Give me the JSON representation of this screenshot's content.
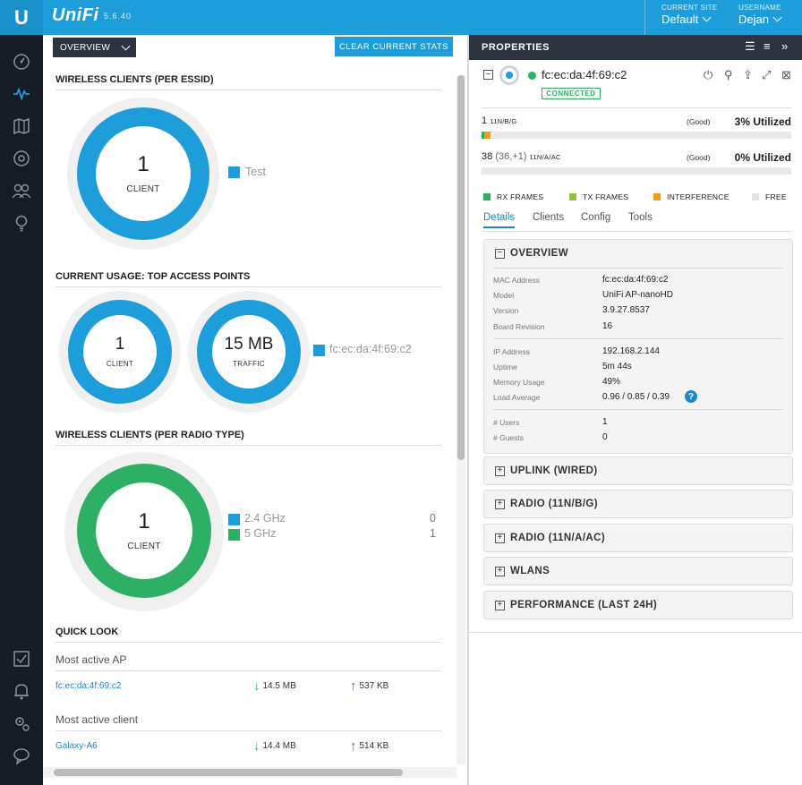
{
  "app": {
    "logo_letter": "U",
    "brand": "UniFi",
    "version": "5.6.40"
  },
  "topbar": {
    "site_label": "CURRENT SITE",
    "site_value": "Default",
    "user_label": "USERNAME",
    "user_value": "Dejan"
  },
  "sidebar": {
    "items": [
      "dashboard-icon",
      "statistics-icon",
      "map-icon",
      "devices-icon",
      "clients-icon",
      "insights-icon",
      "alerts-checklist-icon",
      "events-bell-icon",
      "settings-icon",
      "chat-icon"
    ]
  },
  "main": {
    "view_select": "OVERVIEW",
    "clear_button": "CLEAR CURRENT STATS",
    "wc_essid": {
      "title": "WIRELESS CLIENTS (PER ESSID)",
      "count": "1",
      "unit": "CLIENT",
      "legend": [
        {
          "label": "Test",
          "color": "#1e9ddb"
        }
      ]
    },
    "usage": {
      "title": "CURRENT USAGE: TOP ACCESS POINTS",
      "clients_value": "1",
      "clients_unit": "CLIENT",
      "traffic_value": "15 MB",
      "traffic_unit": "TRAFFIC",
      "legend": "fc:ec:da:4f:69:c2"
    },
    "wc_radio": {
      "title": "WIRELESS CLIENTS (PER RADIO TYPE)",
      "count": "1",
      "unit": "CLIENT",
      "legend": [
        {
          "label": "2.4 GHz",
          "count": "0",
          "color": "#1e9ddb"
        },
        {
          "label": "5 GHz",
          "count": "1",
          "color": "#2db063"
        }
      ]
    },
    "quick_look": {
      "title": "QUICK LOOK",
      "ap_label": "Most active AP",
      "ap_name": "fc:ec:da:4f:69:c2",
      "ap_down": "14.5 MB",
      "ap_up": "537 KB",
      "client_label": "Most active client",
      "client_name": "Galaxy-A6",
      "client_down": "14.4 MB",
      "client_up": "514 KB"
    }
  },
  "properties": {
    "title": "PROPERTIES",
    "device_name": "fc:ec:da:4f:69:c2",
    "status": "CONNECTED",
    "radio1": {
      "count": "1",
      "band": "11N/B/G",
      "quality": "(Good)",
      "util": "3% Utilized",
      "util_value": 0.03
    },
    "radio2": {
      "count": "38",
      "extra": "(36,+1)",
      "band": "11N/A/AC",
      "quality": "(Good)",
      "util": "0% Utilized",
      "util_value": 0.0
    },
    "key": [
      {
        "label": "RX FRAMES",
        "color": "#2db063"
      },
      {
        "label": "TX FRAMES",
        "color": "#8cc63f"
      },
      {
        "label": "INTERFERENCE",
        "color": "#f39c12"
      },
      {
        "label": "FREE",
        "color": "#e4e4e4"
      }
    ],
    "tabs": [
      "Details",
      "Clients",
      "Config",
      "Tools"
    ],
    "overview": {
      "title": "OVERVIEW",
      "rows": [
        {
          "label": "MAC Address",
          "value": "fc:ec:da:4f:69:c2"
        },
        {
          "label": "Model",
          "value": "UniFi AP-nanoHD"
        },
        {
          "label": "Version",
          "value": "3.9.27.8537"
        },
        {
          "label": "Board Revision",
          "value": "16"
        },
        {
          "label": "IP Address",
          "value": "192.168.2.144"
        },
        {
          "label": "Uptime",
          "value": "5m 44s"
        },
        {
          "label": "Memory Usage",
          "value": "49%"
        },
        {
          "label": "Load Average",
          "value": "0.96 / 0.85 / 0.39"
        },
        {
          "label": "# Users",
          "value": "1"
        },
        {
          "label": "# Guests",
          "value": "0"
        }
      ]
    },
    "sections": [
      "UPLINK (WIRED)",
      "RADIO (11N/B/G)",
      "RADIO (11N/A/AC)",
      "WLANS",
      "PERFORMANCE (LAST 24H)"
    ]
  }
}
